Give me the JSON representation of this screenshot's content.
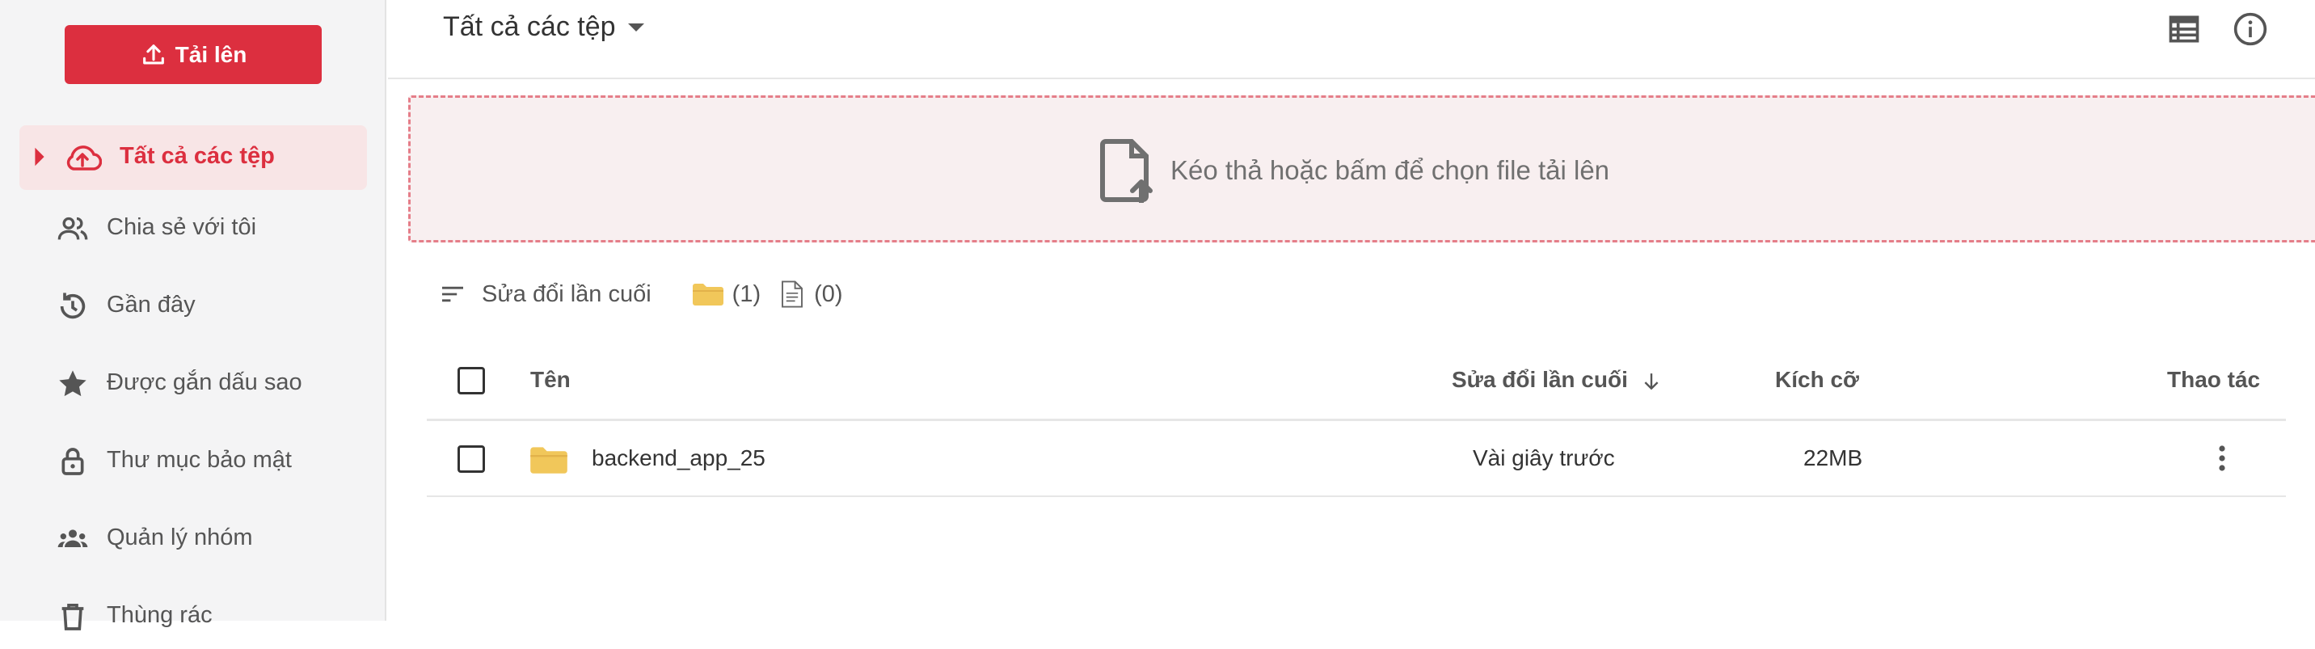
{
  "sidebar": {
    "upload_label": "Tải lên",
    "items": [
      {
        "label": "Tất cả các tệp",
        "icon": "cloud-upload-icon",
        "active": true
      },
      {
        "label": "Chia sẻ với tôi",
        "icon": "people-icon"
      },
      {
        "label": "Gần đây",
        "icon": "history-icon"
      },
      {
        "label": "Được gắn dấu sao",
        "icon": "star-icon"
      },
      {
        "label": "Thư mục bảo mật",
        "icon": "lock-icon"
      },
      {
        "label": "Quản lý nhóm",
        "icon": "groups-icon"
      },
      {
        "label": "Thùng rác",
        "icon": "trash-icon"
      }
    ]
  },
  "header": {
    "title": "Tất cả các tệp",
    "icons": [
      "list-view-icon",
      "info-icon"
    ]
  },
  "dropzone": {
    "text": "Kéo thả hoặc bấm để chọn file tải lên"
  },
  "sortbar": {
    "sort_label": "Sửa đổi lần cuối",
    "folder_count": "(1)",
    "file_count": "(0)"
  },
  "table": {
    "columns": {
      "name": "Tên",
      "modified": "Sửa đổi lần cuối",
      "size": "Kích cỡ",
      "actions": "Thao tác"
    },
    "rows": [
      {
        "name": "backend_app_25",
        "modified": "Vài giây trước",
        "size": "22MB"
      }
    ]
  },
  "colors": {
    "accent": "#dc2f3f",
    "active_bg": "#f8e5e6",
    "dropzone_bg": "#f8eff0",
    "dropzone_border": "#e57e89",
    "folder": "#f1c75a"
  }
}
